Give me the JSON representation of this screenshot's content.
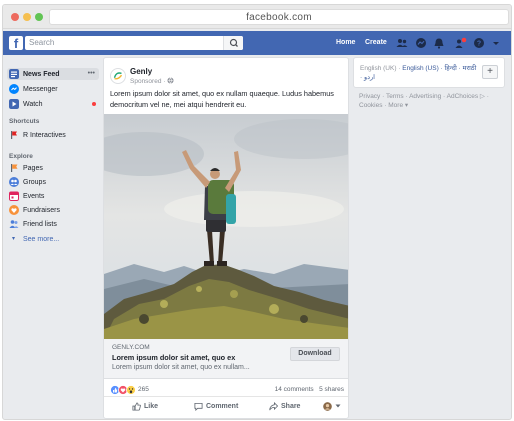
{
  "browser": {
    "url": "facebook.com"
  },
  "topbar": {
    "search_placeholder": "Search",
    "home_label": "Home",
    "create_label": "Create"
  },
  "sidebar": {
    "items": [
      {
        "label": "News Feed",
        "icon": "news-feed-icon",
        "more": "•••"
      },
      {
        "label": "Messenger",
        "icon": "messenger-icon"
      },
      {
        "label": "Watch",
        "icon": "watch-icon"
      }
    ],
    "shortcuts_heading": "Shortcuts",
    "shortcuts": [
      {
        "label": "R Interactives"
      }
    ],
    "explore_heading": "Explore",
    "explore": [
      {
        "label": "Pages",
        "icon": "pages-flag-icon"
      },
      {
        "label": "Groups",
        "icon": "groups-icon"
      },
      {
        "label": "Events",
        "icon": "events-calendar-icon"
      },
      {
        "label": "Fundraisers",
        "icon": "fundraisers-icon"
      },
      {
        "label": "Friend lists",
        "icon": "friend-lists-icon"
      }
    ],
    "see_more": "See more..."
  },
  "post": {
    "page_name": "Genly",
    "sponsored": "Sponsored ·",
    "text": "Lorem ipsum dolor sit amet, quo ex nullam quaeque. Ludus habemus democritum vel ne, mei atqui hendrerit eu.",
    "link": {
      "domain": "GENLY.COM",
      "title": "Lorem ipsum dolor sit amet, quo ex",
      "description": "Lorem ipsum dolor sit amet, quo ex nullam...",
      "cta": "Download"
    },
    "reactions_count": "265",
    "comments": "14 comments",
    "shares": "5 shares",
    "actions": {
      "like": "Like",
      "comment": "Comment",
      "share": "Share"
    }
  },
  "right_panel": {
    "languages_prefix": "English (UK) · ",
    "languages_links": "English (US) · हिन्दी · मराठी · اردو",
    "add_button": "+",
    "footer": "Privacy · Terms · Advertising · AdChoices ▷ · Cookies · More ▾"
  },
  "colors": {
    "brand": "#4267b2",
    "link": "#385898",
    "notification": "#fa3e3e"
  }
}
